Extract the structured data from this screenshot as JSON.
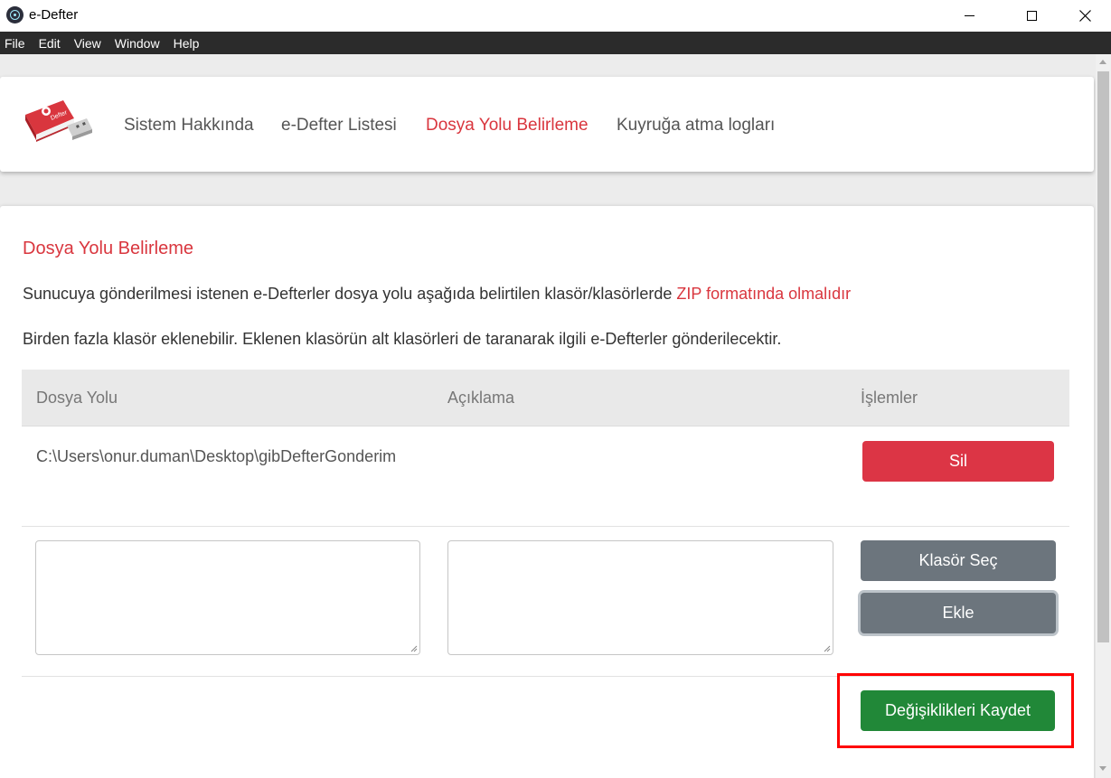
{
  "window": {
    "title": "e-Defter",
    "minimize_icon": "minimize-icon",
    "maximize_icon": "maximize-icon",
    "close_icon": "close-icon"
  },
  "menu": {
    "items": [
      "File",
      "Edit",
      "View",
      "Window",
      "Help"
    ]
  },
  "nav": {
    "logo_text": "Defter",
    "links": [
      "Sistem Hakkında",
      "e-Defter Listesi",
      "Dosya Yolu Belirleme",
      "Kuyruğa atma logları"
    ],
    "active_index": 2
  },
  "page": {
    "title": "Dosya Yolu Belirleme",
    "paragraph1_text": "Sunucuya gönderilmesi istenen e-Defterler dosya yolu aşağıda belirtilen klasör/klasörlerde ",
    "paragraph1_highlight": "ZIP formatında olmalıdır",
    "paragraph2": "Birden fazla klasör eklenebilir. Eklenen klasörün alt klasörleri de taranarak ilgili e-Defterler gönderilecektir."
  },
  "table": {
    "headers": [
      "Dosya Yolu",
      "Açıklama",
      "İşlemler"
    ],
    "rows": [
      {
        "path": "C:\\Users\\onur.duman\\Desktop\\gibDefterGonderim",
        "description": "",
        "action_label": "Sil"
      }
    ]
  },
  "form": {
    "path_value": "",
    "description_value": "",
    "choose_folder_label": "Klasör Seç",
    "add_label": "Ekle"
  },
  "save_label": "Değişiklikleri Kaydet",
  "colors": {
    "accent_red": "#d9363e",
    "danger": "#dc3545",
    "secondary": "#6c757d",
    "success": "#218838",
    "menubar": "#2b2b2b",
    "annotation_box": "#ff0000"
  }
}
